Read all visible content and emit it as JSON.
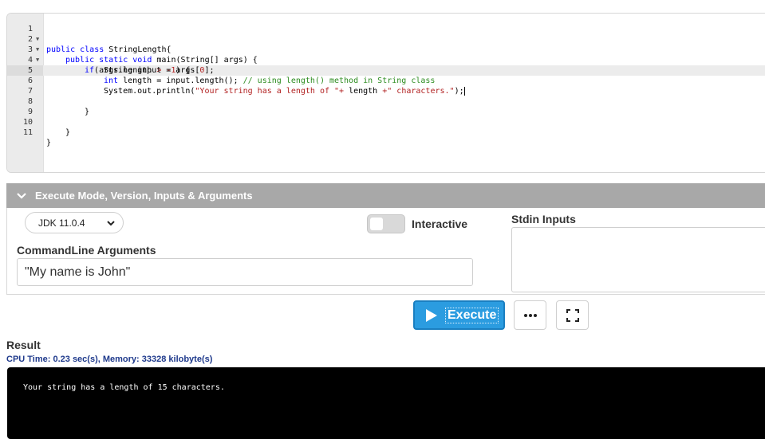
{
  "editor": {
    "lines": [
      {
        "n": "1",
        "fold": true
      },
      {
        "n": "2",
        "fold": true
      },
      {
        "n": "3",
        "fold": true
      },
      {
        "n": "4",
        "fold": false
      },
      {
        "n": "5",
        "fold": false
      },
      {
        "n": "6",
        "fold": false
      },
      {
        "n": "7",
        "fold": false
      },
      {
        "n": "8",
        "fold": false
      },
      {
        "n": "9",
        "fold": false
      },
      {
        "n": "10",
        "fold": false
      },
      {
        "n": "11",
        "fold": false
      }
    ],
    "code": {
      "l1_kw": "public class",
      "l1_rest": " StringLength{",
      "l2_kw": "public static void",
      "l2_rest": " main(String[] args) {",
      "l3_kw": "if",
      "l3_a": "(args.length ",
      "l3_op": "> -1",
      "l3_b": ") {",
      "l4_a": "String input = args[",
      "l4_num": "0",
      "l4_b": "];",
      "l5_kw": "int",
      "l5_a": " length = input.length(); ",
      "l5_cmt": "// using length() method in String class",
      "l6_a": "System",
      "l6_b": ".out.println(",
      "l6_s1": "\"Your string has a length of \"",
      "l6_op1": "+",
      "l6_c": " length ",
      "l6_op2": "+",
      "l6_s2": "\" characters.\"",
      "l6_d": ");",
      "l8": "}",
      "l10": "}",
      "l11": "}"
    }
  },
  "execute_panel": {
    "title": "Execute Mode, Version, Inputs & Arguments",
    "version": "JDK 11.0.4",
    "interactive_label": "Interactive",
    "interactive_on": false,
    "stdin_label": "Stdin Inputs",
    "stdin_value": "",
    "args_label": "CommandLine Arguments",
    "args_value": "\"My name is John\""
  },
  "actions": {
    "execute_label": "Execute",
    "more_icon": "ellipsis-icon",
    "fullscreen_icon": "fullscreen-icon"
  },
  "result": {
    "title": "Result",
    "stats": "CPU Time: 0.23 sec(s), Memory: 33328 kilobyte(s)",
    "output": "Your string has a length of 15 characters."
  },
  "colors": {
    "execute_bg": "#2b9ce0",
    "panel_head_bg": "#a8a8a8",
    "stats_text": "#1f3a8c",
    "console_bg": "#000000"
  }
}
